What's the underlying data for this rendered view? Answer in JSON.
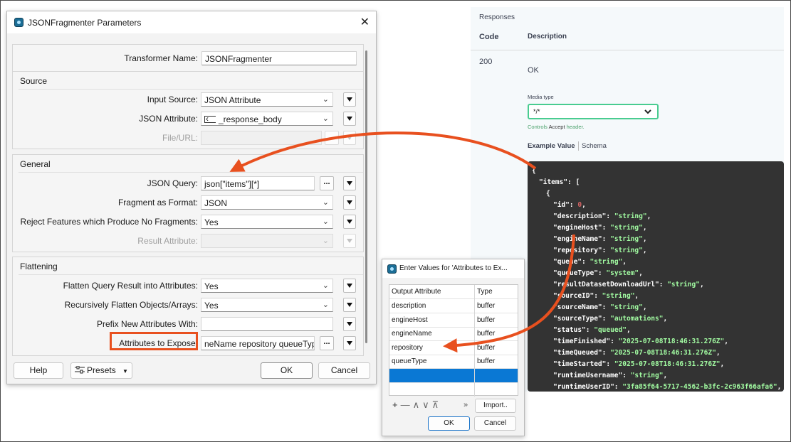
{
  "main_dialog": {
    "title": "JSONFragmenter Parameters",
    "close_glyph": "✕",
    "transformer_name": {
      "label": "Transformer Name:",
      "value": "JSONFragmenter"
    },
    "sections": {
      "source": "Source",
      "general": "General",
      "flattening": "Flattening"
    },
    "source": {
      "input_source": {
        "label": "Input Source:",
        "value": "JSON Attribute"
      },
      "json_attribute": {
        "label": "JSON Attribute:",
        "value": "_response_body"
      },
      "file_url": {
        "label": "File/URL:",
        "value": ""
      }
    },
    "general": {
      "json_query": {
        "label": "JSON Query:",
        "value": "json[\"items\"][*]"
      },
      "fragment_format": {
        "label": "Fragment as Format:",
        "value": "JSON"
      },
      "reject_features": {
        "label": "Reject Features which Produce No Fragments:",
        "value": "Yes"
      },
      "result_attribute": {
        "label": "Result Attribute:",
        "value": ""
      }
    },
    "flattening": {
      "flatten_query": {
        "label": "Flatten Query Result into Attributes:",
        "value": "Yes"
      },
      "recursive_flatten": {
        "label": "Recursively Flatten Objects/Arrays:",
        "value": "Yes"
      },
      "prefix": {
        "label": "Prefix New Attributes With:",
        "value": ""
      },
      "attributes_expose": {
        "label": "Attributes to Expose:",
        "value": "neName repository queueType"
      }
    },
    "ellipsis": "...",
    "buttons": {
      "help": "Help",
      "presets": "Presets",
      "ok": "OK",
      "cancel": "Cancel"
    }
  },
  "swagger": {
    "responses_label": "Responses",
    "col_code": "Code",
    "col_description": "Description",
    "status_code": "200",
    "status_text": "OK",
    "media_type_label": "Media type",
    "media_type_value": "*/*",
    "controls_prefix": "Controls ",
    "controls_accept": "Accept",
    "controls_suffix": " header.",
    "tab_example": "Example Value",
    "tab_schema": "Schema",
    "code_lines": [
      {
        "indent": 0,
        "text": "{"
      },
      {
        "indent": 1,
        "key": "\"items\"",
        "rest": ": ["
      },
      {
        "indent": 2,
        "text": "{"
      },
      {
        "indent": 3,
        "key": "\"id\"",
        "num": "0"
      },
      {
        "indent": 3,
        "key": "\"description\"",
        "str": "\"string\""
      },
      {
        "indent": 3,
        "key": "\"engineHost\"",
        "str": "\"string\""
      },
      {
        "indent": 3,
        "key": "\"engineName\"",
        "str": "\"string\""
      },
      {
        "indent": 3,
        "key": "\"repository\"",
        "str": "\"string\""
      },
      {
        "indent": 3,
        "key": "\"queue\"",
        "str": "\"string\""
      },
      {
        "indent": 3,
        "key": "\"queueType\"",
        "str": "\"system\""
      },
      {
        "indent": 3,
        "key": "\"resultDatasetDownloadUrl\"",
        "str": "\"string\""
      },
      {
        "indent": 3,
        "key": "\"sourceID\"",
        "str": "\"string\""
      },
      {
        "indent": 3,
        "key": "\"sourceName\"",
        "str": "\"string\""
      },
      {
        "indent": 3,
        "key": "\"sourceType\"",
        "str": "\"automations\""
      },
      {
        "indent": 3,
        "key": "\"status\"",
        "str": "\"queued\""
      },
      {
        "indent": 3,
        "key": "\"timeFinished\"",
        "str": "\"2025-07-08T18:46:31.276Z\""
      },
      {
        "indent": 3,
        "key": "\"timeQueued\"",
        "str": "\"2025-07-08T18:46:31.276Z\""
      },
      {
        "indent": 3,
        "key": "\"timeStarted\"",
        "str": "\"2025-07-08T18:46:31.276Z\""
      },
      {
        "indent": 3,
        "key": "\"runtimeUsername\"",
        "str": "\"string\""
      },
      {
        "indent": 3,
        "key": "\"runtimeUserID\"",
        "str": "\"3fa85f64-5717-4562-b3fc-2c963f66afa6\""
      }
    ]
  },
  "values_dialog": {
    "title": "Enter Values for 'Attributes to Ex...",
    "col_output": "Output Attribute",
    "col_type": "Type",
    "rows": [
      {
        "name": "description",
        "type": "buffer"
      },
      {
        "name": "engineHost",
        "type": "buffer"
      },
      {
        "name": "engineName",
        "type": "buffer"
      },
      {
        "name": "repository",
        "type": "buffer"
      },
      {
        "name": "queueType",
        "type": "buffer"
      }
    ],
    "tool_glyphs": "+ — ∧ ∨ ⊼",
    "more_glyph": "»",
    "import_label": "Import..",
    "ok": "OK",
    "cancel": "Cancel"
  },
  "colors": {
    "annotation": "#e8501f",
    "selection": "#0a78d4",
    "code_bg": "#333333",
    "code_string": "#a2fca2"
  }
}
